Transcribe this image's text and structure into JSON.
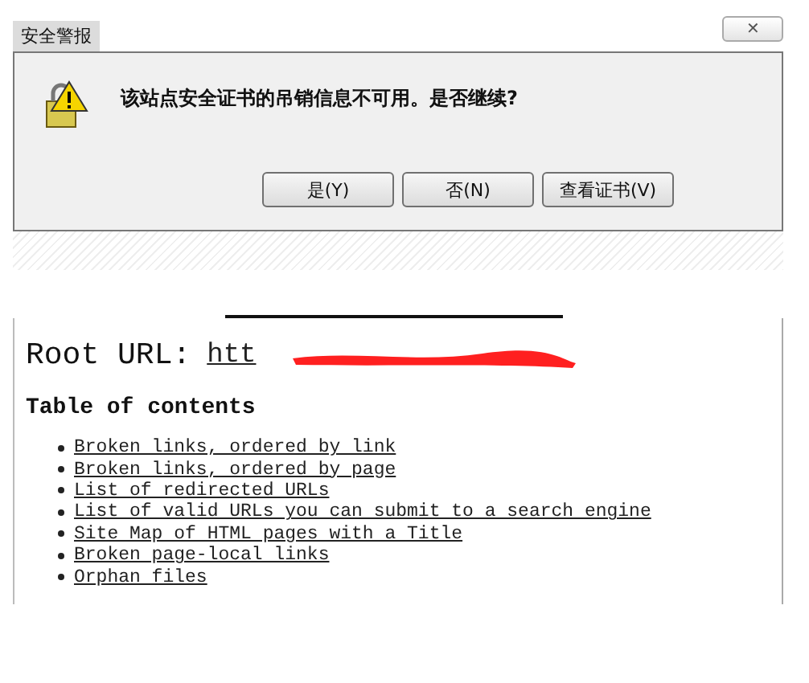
{
  "dialog": {
    "title": "安全警报",
    "close": "✕",
    "message": "该站点安全证书的吊销信息不可用。是否继续?",
    "buttons": [
      "是(Y)",
      "否(N)",
      "查看证书(V)"
    ]
  },
  "page": {
    "root_label": "Root URL:",
    "root_url": "htt",
    "heading": "Table of contents",
    "links": [
      "Broken links, ordered by link",
      "Broken links, ordered by page",
      "List of redirected URLs",
      "List of valid URLs you can submit to a search engine",
      "Site Map of HTML pages with a Title",
      "Broken page-local links",
      "Orphan files"
    ]
  }
}
